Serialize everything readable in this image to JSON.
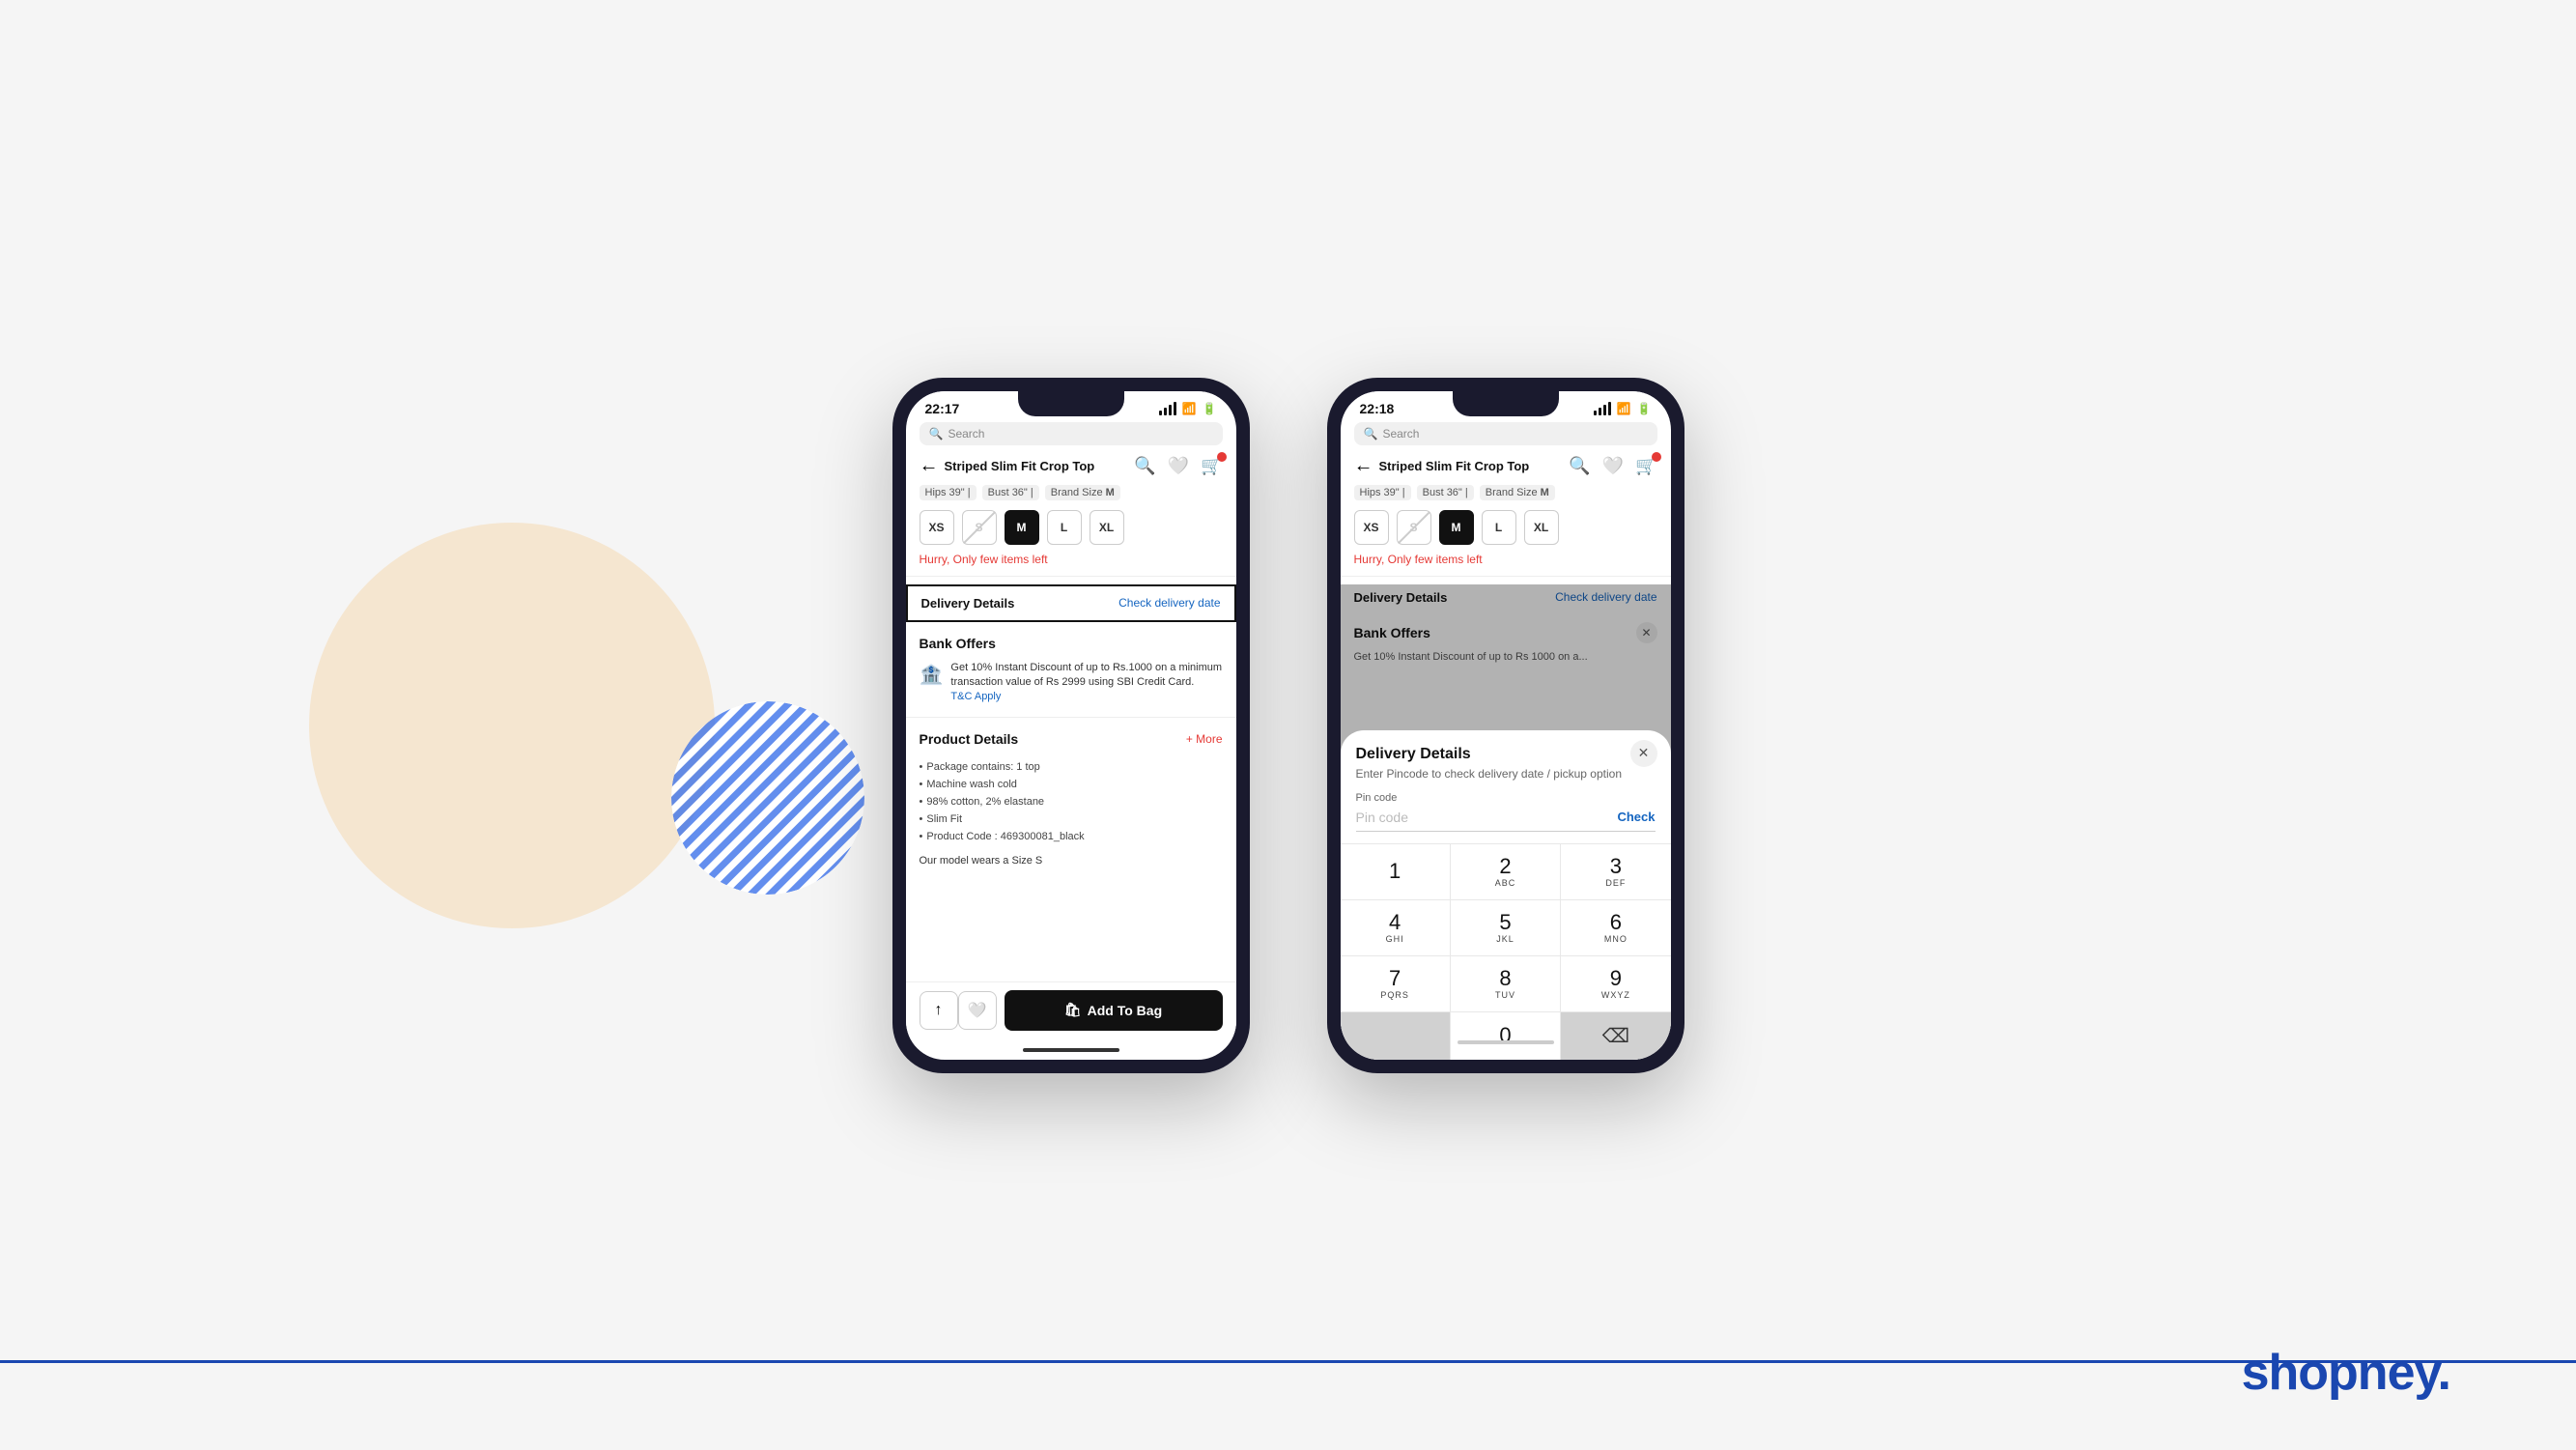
{
  "page": {
    "background": "#f5f5f5"
  },
  "phone1": {
    "status_bar": {
      "time": "22:17",
      "search_placeholder": "Search"
    },
    "nav": {
      "back_label": "←",
      "title": "Striped Slim Fit Crop Top",
      "search_icon": "search",
      "heart_icon": "heart",
      "cart_icon": "cart"
    },
    "specs": [
      {
        "label": "Hips 39\""
      },
      {
        "label": "Bust 36\""
      },
      {
        "label": "Brand Size M"
      }
    ],
    "sizes": [
      "XS",
      "S",
      "M",
      "L",
      "XL"
    ],
    "hurry_text": "Hurry, Only few items left",
    "delivery": {
      "label": "Delivery Details",
      "check_label": "Check delivery date"
    },
    "bank_offers": {
      "title": "Bank Offers",
      "offer_text": "Get 10% Instant Discount of up to Rs.1000 on a minimum transaction value of Rs 2999 using SBI Credit Card.",
      "tnc_label": "T&C Apply"
    },
    "product_details": {
      "title": "Product Details",
      "more_label": "+ More",
      "items": [
        "Package contains: 1 top",
        "Machine wash cold",
        "98% cotton, 2% elastane",
        "Slim Fit",
        "Product Code : 469300081_black"
      ],
      "model_text": "Our model wears a Size S"
    },
    "bottom_bar": {
      "add_to_bag": "Add To Bag"
    }
  },
  "phone2": {
    "status_bar": {
      "time": "22:18",
      "search_placeholder": "Search"
    },
    "nav": {
      "title": "Striped Slim Fit Crop Top"
    },
    "specs": [
      {
        "label": "Hips 39\""
      },
      {
        "label": "Bust 36\""
      },
      {
        "label": "Brand Size M"
      }
    ],
    "sizes": [
      "XS",
      "S",
      "M",
      "L",
      "XL"
    ],
    "hurry_text": "Hurry, Only few items left",
    "delivery": {
      "label": "Delivery Details",
      "check_label": "Check delivery date"
    },
    "bank_offers": {
      "title": "Bank Offers"
    },
    "modal": {
      "title": "Delivery Details",
      "subtitle": "Enter Pincode to check delivery date / pickup option",
      "pin_label": "Pin code",
      "pin_placeholder": "Pin code",
      "check_btn": "Check",
      "keypad": [
        {
          "num": "1",
          "letters": ""
        },
        {
          "num": "2",
          "letters": "ABC"
        },
        {
          "num": "3",
          "letters": "DEF"
        },
        {
          "num": "4",
          "letters": "GHI"
        },
        {
          "num": "5",
          "letters": "JKL"
        },
        {
          "num": "6",
          "letters": "MNO"
        },
        {
          "num": "7",
          "letters": "PQRS"
        },
        {
          "num": "8",
          "letters": "TUV"
        },
        {
          "num": "9",
          "letters": "WXYZ"
        },
        {
          "num": "0",
          "letters": ""
        }
      ]
    }
  },
  "brand": {
    "name": "shopney."
  }
}
